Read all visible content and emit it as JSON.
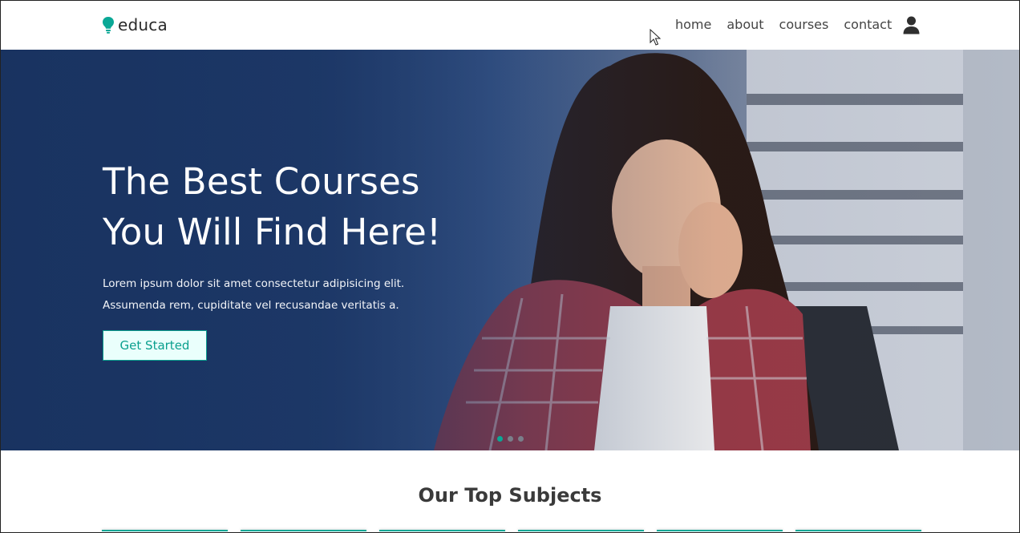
{
  "header": {
    "logo_text": "educa",
    "nav": [
      "home",
      "about",
      "courses",
      "contact"
    ]
  },
  "hero": {
    "title_line1": "The Best Courses",
    "title_line2": "You Will Find Here!",
    "text": "Lorem ipsum dolor sit amet consectetur adipisicing elit. Assumenda rem, cupiditate vel recusandae veritatis a.",
    "button_label": "Get Started",
    "slides": 3,
    "active_slide": 1
  },
  "subjects": {
    "title": "Our Top Subjects",
    "card_count": 6
  },
  "colors": {
    "accent": "#0aa896",
    "hero_blue": "#1f3a6c",
    "button_bg": "#eafffc"
  },
  "icons": {
    "logo": "lightbulb-icon",
    "account": "user-icon",
    "pointer": "mouse-cursor-icon"
  }
}
